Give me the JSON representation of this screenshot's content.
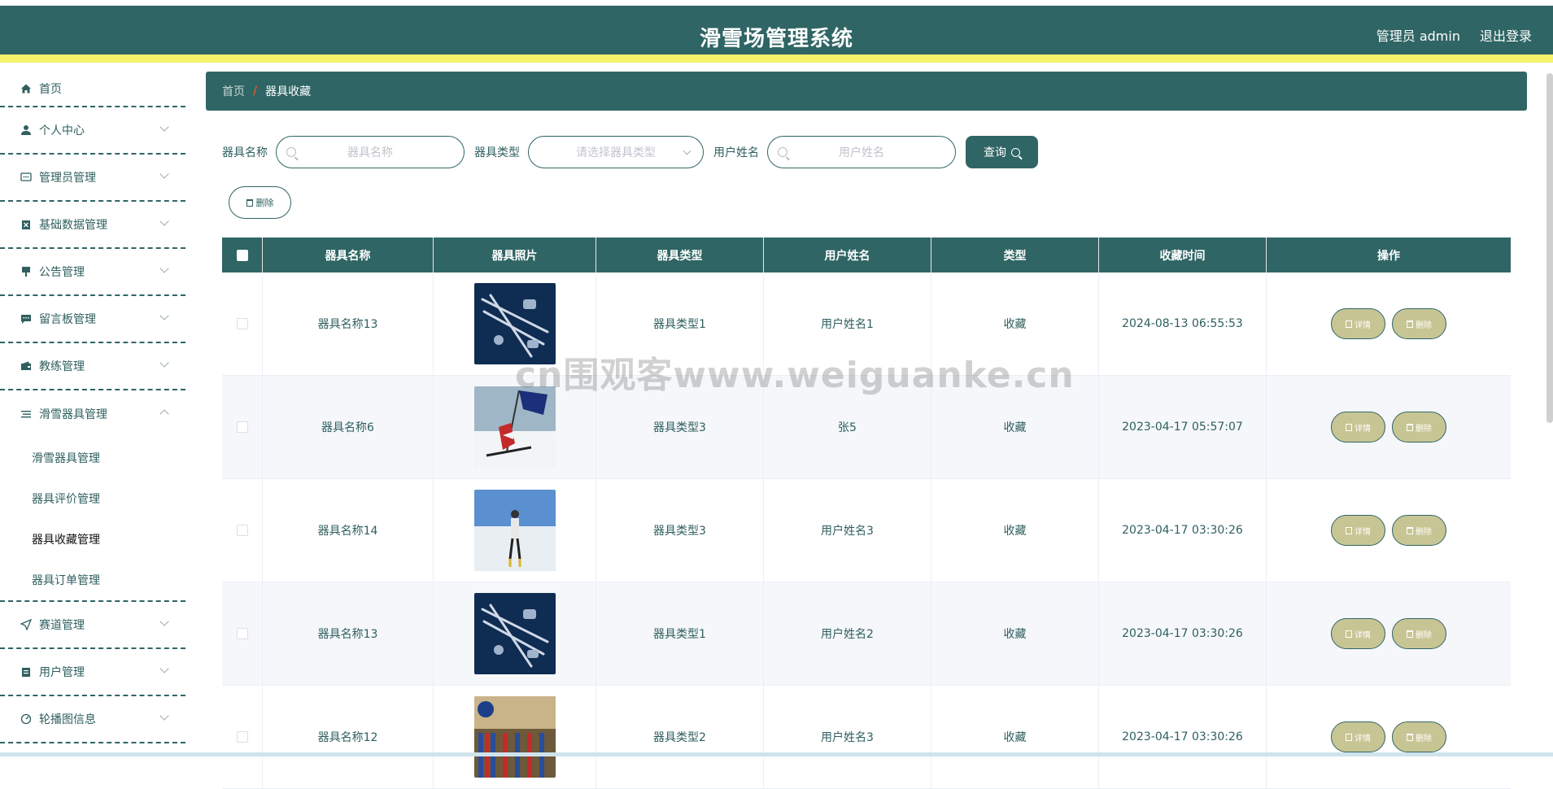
{
  "header": {
    "title": "滑雪场管理系统",
    "user": "管理员 admin",
    "logout": "退出登录"
  },
  "sidebar": {
    "items": [
      {
        "label": "首页",
        "icon": "home-icon"
      },
      {
        "label": "个人中心",
        "icon": "user-icon"
      },
      {
        "label": "管理员管理",
        "icon": "chat-icon"
      },
      {
        "label": "基础数据管理",
        "icon": "clipboard-icon"
      },
      {
        "label": "公告管理",
        "icon": "brush-icon"
      },
      {
        "label": "留言板管理",
        "icon": "message-icon"
      },
      {
        "label": "教练管理",
        "icon": "wallet-icon"
      },
      {
        "label": "滑雪器具管理",
        "icon": "list-icon"
      },
      {
        "label": "赛道管理",
        "icon": "navigation-icon"
      },
      {
        "label": "用户管理",
        "icon": "clipboard-icon"
      },
      {
        "label": "轮播图信息",
        "icon": "gauge-icon"
      }
    ],
    "submenu": [
      "滑雪器具管理",
      "器具评价管理",
      "器具收藏管理",
      "器具订单管理"
    ]
  },
  "breadcrumb": {
    "home": "首页",
    "separator": "/",
    "current": "器具收藏"
  },
  "search": {
    "name_label": "器具名称",
    "name_placeholder": "器具名称",
    "type_label": "器具类型",
    "type_placeholder": "请选择器具类型",
    "user_label": "用户姓名",
    "user_placeholder": "用户姓名",
    "query": "查询"
  },
  "actions": {
    "delete": "删除"
  },
  "table": {
    "columns": [
      "器具名称",
      "器具照片",
      "器具类型",
      "用户姓名",
      "类型",
      "收藏时间",
      "操作"
    ],
    "rows": [
      {
        "name": "器具名称13",
        "photo": "ski-gear",
        "type": "器具类型1",
        "user": "用户姓名1",
        "kind": "收藏",
        "time": "2024-08-13 06:55:53"
      },
      {
        "name": "器具名称6",
        "photo": "skier-flag",
        "type": "器具类型3",
        "user": "张5",
        "kind": "收藏",
        "time": "2023-04-17 05:57:07"
      },
      {
        "name": "器具名称14",
        "photo": "skier-snow",
        "type": "器具类型3",
        "user": "用户姓名3",
        "kind": "收藏",
        "time": "2023-04-17 03:30:26"
      },
      {
        "name": "器具名称13",
        "photo": "ski-gear",
        "type": "器具类型1",
        "user": "用户姓名2",
        "kind": "收藏",
        "time": "2023-04-17 03:30:26"
      },
      {
        "name": "器具名称12",
        "photo": "ski-shop",
        "type": "器具类型2",
        "user": "用户姓名3",
        "kind": "收藏",
        "time": "2023-04-17 03:30:26"
      }
    ],
    "detail": "详情",
    "delete": "删除"
  },
  "watermark": "cn围观客www.weiguanke.cn"
}
